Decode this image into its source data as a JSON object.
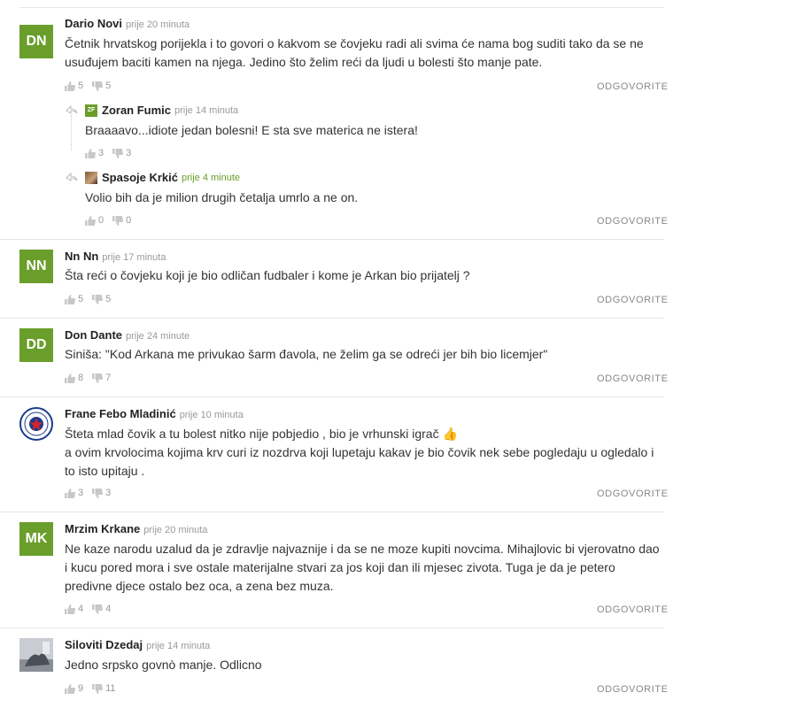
{
  "reply_label": "ODGOVORITE",
  "colors": {
    "avatar_green": "#6a9e2a",
    "separator": "#e6e6e6",
    "muted": "#999999"
  },
  "comments": [
    {
      "initials": "DN",
      "name": "Dario Novi",
      "time": "prije 20 minuta",
      "text_lines": [
        "Četnik hrvatskog porijekla i to govori o kakvom se čovjeku radi ali svima će nama bog suditi tako da se ne",
        "usuđujem baciti kamen na njega. Jedino što želim reći da ljudi u bolesti što manje pate."
      ],
      "likes": "5",
      "dislikes": "5",
      "replies": [
        {
          "avatar_text": "ZF",
          "name": "Zoran Fumic",
          "time": "prije 14 minuta",
          "text": "Braaaavo...idiote jedan bolesni! E sta sve materica ne istera!",
          "likes": "3",
          "dislikes": "3"
        },
        {
          "avatar_icon": "photo-avatar",
          "name": "Spasoje Krkić",
          "time": "prije 4 minute",
          "text": "Volio bih da je milion drugih četalja umrlo a ne on.",
          "likes": "0",
          "dislikes": "0"
        }
      ]
    },
    {
      "initials": "NN",
      "name": "Nn Nn",
      "time": "prije 17 minuta",
      "text_lines": [
        "Šta reći o čovjeku koji je bio odličan fudbaler i kome je Arkan bio prijatelj ?"
      ],
      "likes": "5",
      "dislikes": "5"
    },
    {
      "initials": "DD",
      "name": "Don Dante",
      "time": "prije 24 minute",
      "text_lines": [
        "Siniša: \"Kod Arkana me privukao šarm đavola, ne želim ga se odreći jer bih bio licemjer\""
      ],
      "likes": "8",
      "dislikes": "7"
    },
    {
      "avatar_icon": "club-crest-icon",
      "name": "Frane Febo Mladinić",
      "time": "prije 10 minuta",
      "text_lines": [
        "Šteta mlad čovik a tu bolest nitko nije pobjedio , bio je vrhunski igrač 👍",
        "a ovim krvolocima kojima krv curi iz nozdrva koji lupetaju kakav je bio čovik nek sebe pogledaju u ogledalo i",
        "to isto upitaju ."
      ],
      "likes": "3",
      "dislikes": "3"
    },
    {
      "initials": "MK",
      "name": "Mrzim Krkane",
      "time": "prije 20 minuta",
      "text_lines": [
        "Ne kaze narodu uzalud da je zdravlje najvaznije i da se ne moze kupiti novcima. Mihajlovic bi vjerovatno dao",
        "i kucu pored mora i sve ostale materijalne stvari za jos koji dan ili mjesec zivota. Tuga je da je petero",
        "predivne djece ostalo bez oca, a zena bez muza."
      ],
      "likes": "4",
      "dislikes": "4"
    },
    {
      "avatar_icon": "photo-avatar",
      "name": "Siloviti Dzedaj",
      "time": "prije 14 minuta",
      "text_lines": [
        "Jedno srpsko govnò manje. Odlicno"
      ],
      "likes": "9",
      "dislikes": "11"
    }
  ]
}
